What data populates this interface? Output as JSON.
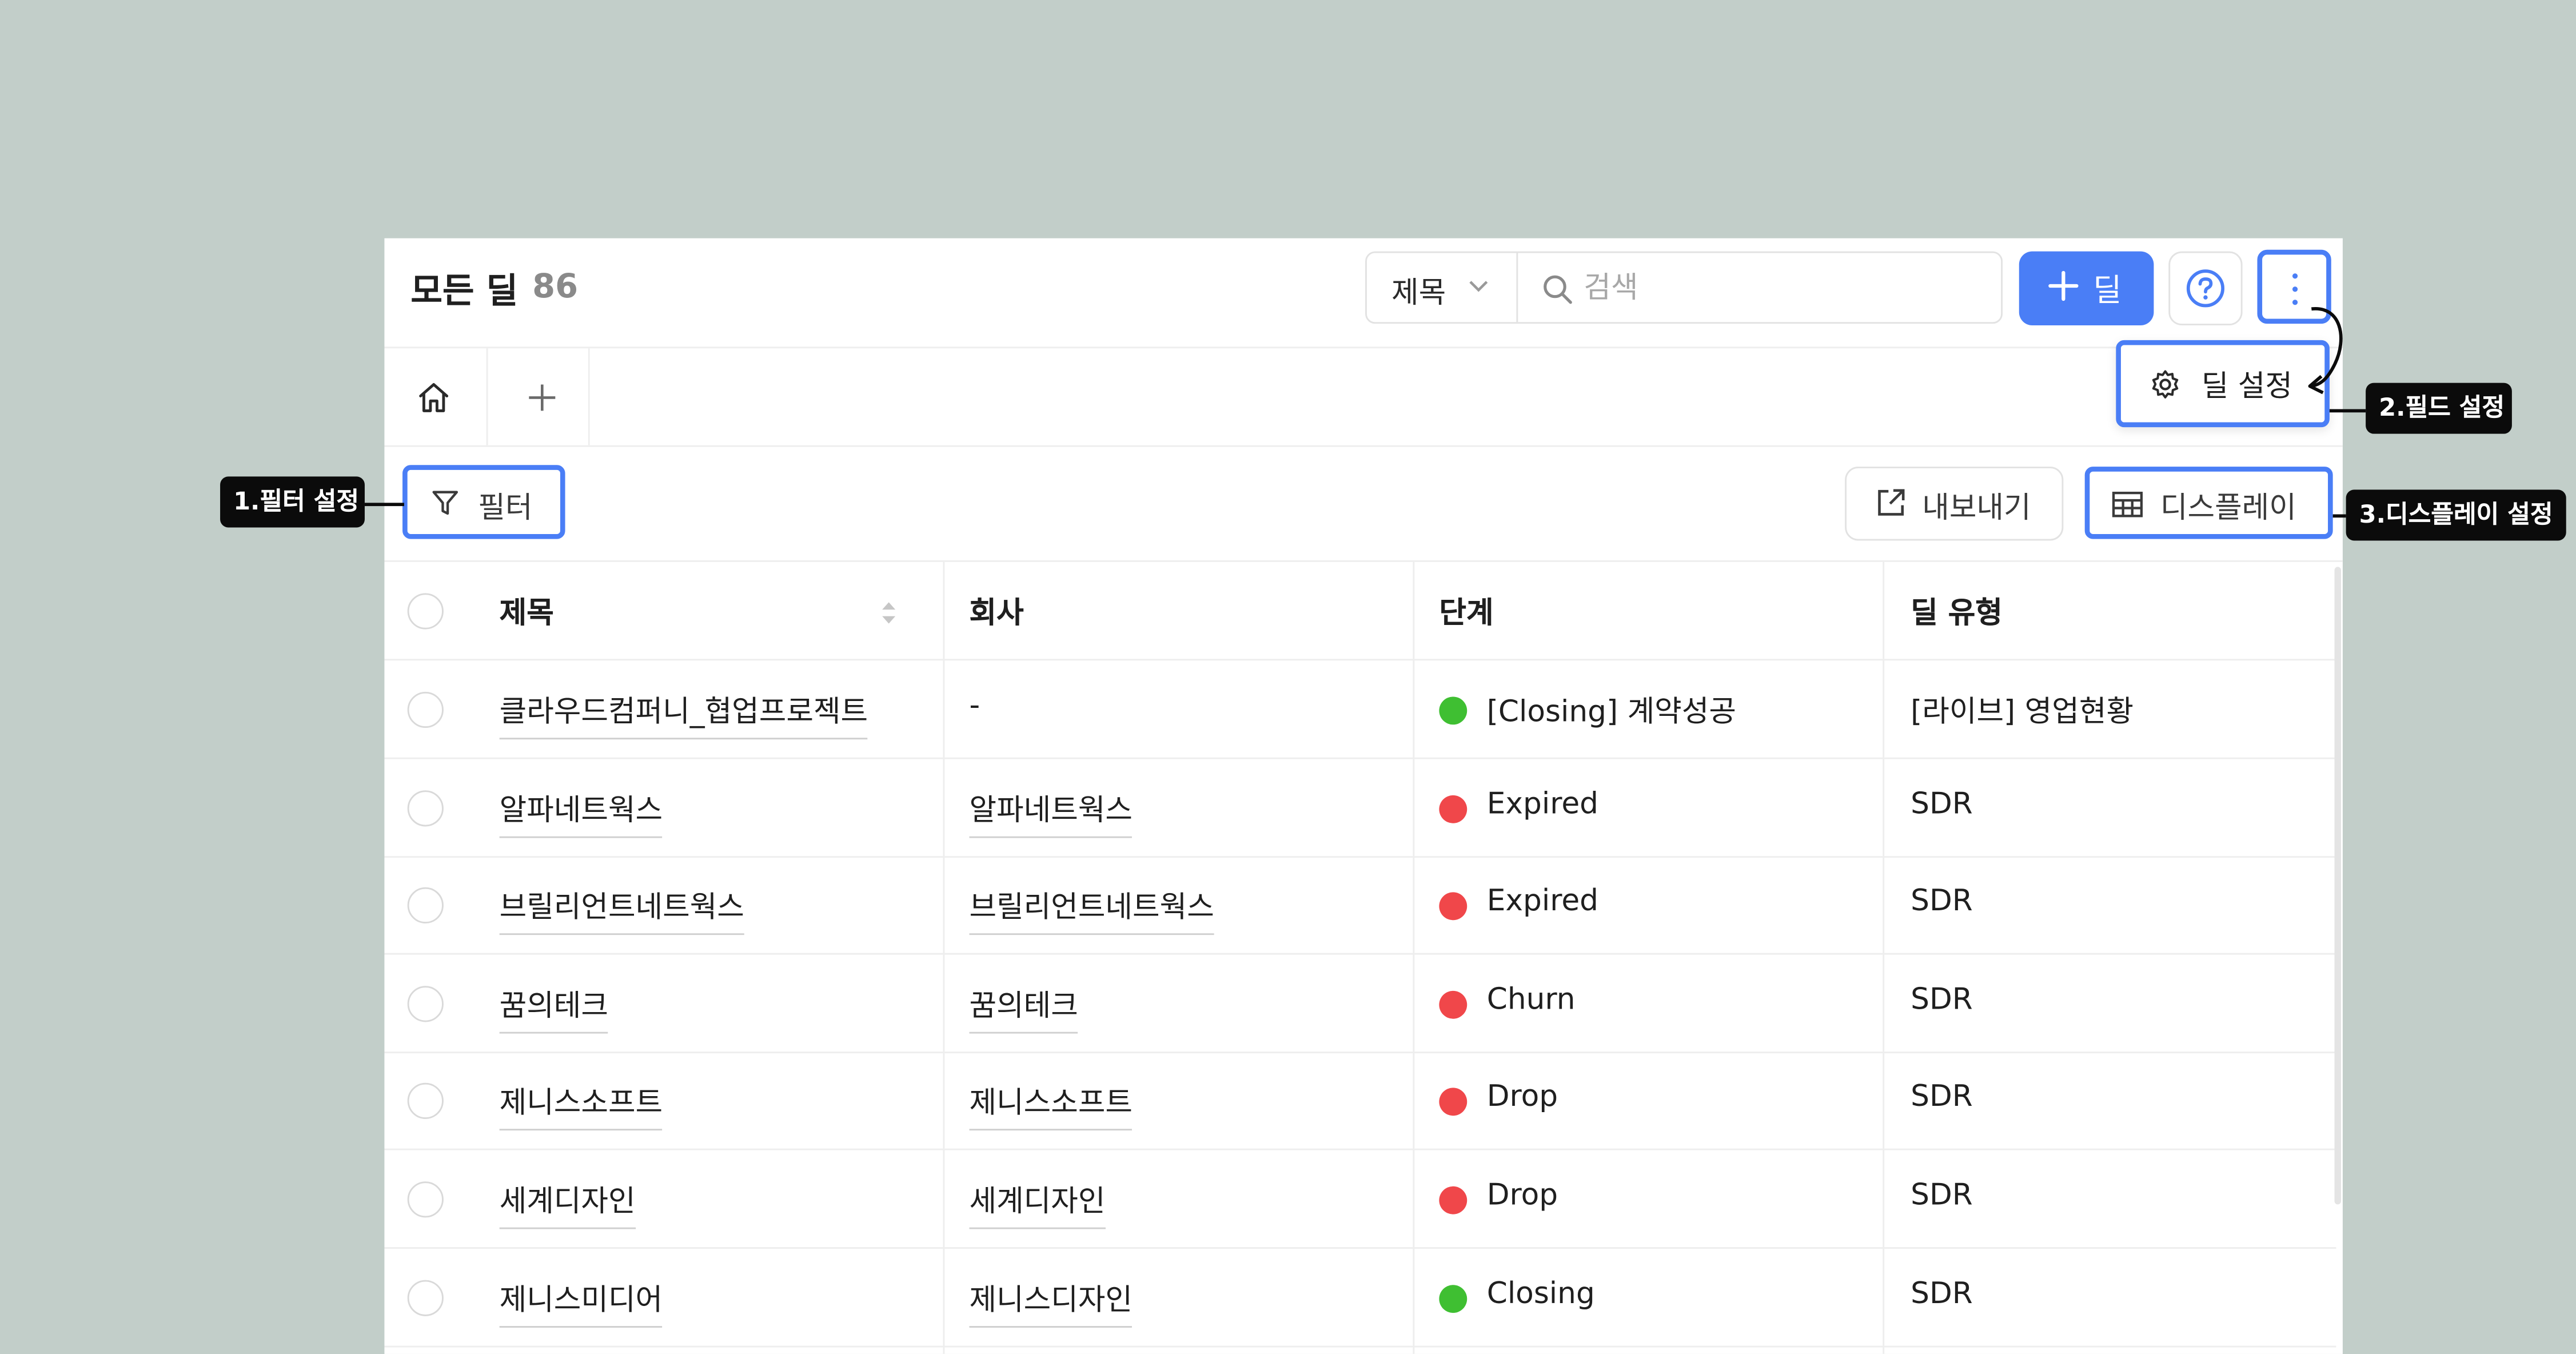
{
  "header": {
    "title": "모든 딜",
    "count": "86",
    "search_field": "제목",
    "search_placeholder": "검색",
    "add_button_label": "딜"
  },
  "toolbar": {
    "filter_label": "필터",
    "export_label": "내보내기",
    "display_label": "디스플레이"
  },
  "settings_menu": {
    "item_label": "딜 설정"
  },
  "annotations": {
    "filter": "1.필터 설정",
    "field": "2.필드 설정",
    "display": "3.디스플레이 설정"
  },
  "table": {
    "columns": [
      "제목",
      "회사",
      "단계",
      "딜 유형"
    ],
    "rows": [
      {
        "title": "클라우드컴퍼니_협업프로젝트",
        "company": "-",
        "stage": "[Closing] 계약성공",
        "stage_color": "#3fbf32",
        "type": "[라이브] 영업현황"
      },
      {
        "title": "알파네트웍스",
        "company": "알파네트웍스",
        "stage": "Expired",
        "stage_color": "#f0474a",
        "type": "SDR"
      },
      {
        "title": "브릴리언트네트웍스",
        "company": "브릴리언트네트웍스",
        "stage": "Expired",
        "stage_color": "#f0474a",
        "type": "SDR"
      },
      {
        "title": "꿈의테크",
        "company": "꿈의테크",
        "stage": "Churn",
        "stage_color": "#f0474a",
        "type": "SDR"
      },
      {
        "title": "제니스소프트",
        "company": "제니스소프트",
        "stage": "Drop",
        "stage_color": "#f0474a",
        "type": "SDR"
      },
      {
        "title": "세계디자인",
        "company": "세계디자인",
        "stage": "Drop",
        "stage_color": "#f0474a",
        "type": "SDR"
      },
      {
        "title": "제니스미디어",
        "company": "제니스디자인",
        "stage": "Closing",
        "stage_color": "#3fbf32",
        "type": "SDR"
      }
    ]
  },
  "colors": {
    "accent": "#4a7ef6",
    "background": "#c2cec9",
    "annotation": "#0b0b0b"
  },
  "icons": [
    "search-icon",
    "chevron-down-icon",
    "plus-icon",
    "help-icon",
    "more-vertical-icon",
    "home-icon",
    "filter-icon",
    "export-icon",
    "table-icon",
    "gear-icon",
    "sort-icon"
  ]
}
